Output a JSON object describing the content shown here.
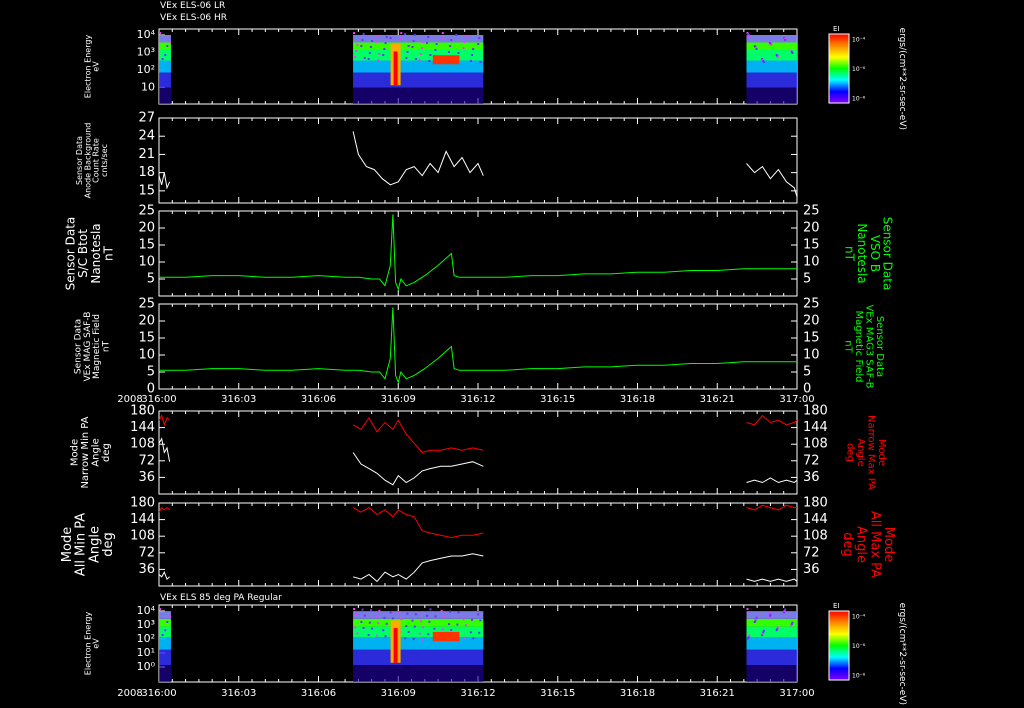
{
  "header": {
    "line1": "VEx ELS-06 LR",
    "line2": "VEx ELS-06 HR",
    "bottom_title": "VEx ELS 85 deg PA Regular"
  },
  "year_label": "2008",
  "colorbar": {
    "label": "EI",
    "units": "ergs/(cm**2-sr-sec-eV)",
    "ticks": [
      "10⁻⁴",
      "10⁻⁶",
      "10⁻⁸"
    ],
    "colors": [
      "#ff0000",
      "#ff8800",
      "#ffff00",
      "#00ff00",
      "#00ffff",
      "#0000ff",
      "#8800ff"
    ]
  },
  "colors": {
    "axis": "#ffffff",
    "green_series": "#00ff00",
    "red_series": "#ff0000",
    "white_series": "#ffffff"
  },
  "chart_data": [
    {
      "type": "heatmap",
      "id": "els-energy-top",
      "ylabel": [
        "Electron Energy",
        "eV"
      ],
      "ylim": [
        1,
        30000
      ],
      "yscale": "log",
      "yticks": [
        "10⁴",
        "10³",
        "10²",
        "10"
      ],
      "x": [
        "316:00",
        "316:03",
        "316:06",
        "316:09",
        "316:12",
        "316:15",
        "316:18",
        "316:21",
        "317:00"
      ],
      "data_intervals": [
        {
          "start": "316:00",
          "end": "316:00.5"
        },
        {
          "start": "316:07.3",
          "end": "316:12.2"
        },
        {
          "start": "316:22.1",
          "end": "317:00"
        }
      ]
    },
    {
      "type": "line",
      "id": "anode-background",
      "ylabel": [
        "Sensor Data",
        "Anode Background",
        "Count Rate",
        "cnts/sec"
      ],
      "ylim": [
        13,
        27
      ],
      "yticks": [
        15,
        18,
        21,
        24,
        27
      ],
      "series": [
        {
          "color": "white",
          "x": [
            0.0,
            0.1,
            0.2,
            0.3,
            0.4,
            7.3,
            7.5,
            7.8,
            8.1,
            8.4,
            8.7,
            9.0,
            9.3,
            9.6,
            9.9,
            10.2,
            10.5,
            10.8,
            11.1,
            11.4,
            11.7,
            12.0,
            12.2,
            22.1,
            22.4,
            22.7,
            23.0,
            23.3,
            23.6,
            23.9,
            24.0
          ],
          "y": [
            17.5,
            16,
            18,
            15.5,
            16.5,
            24.8,
            21,
            19,
            18.5,
            17,
            16,
            16.5,
            18.5,
            19,
            17.5,
            19.5,
            18,
            21.5,
            19,
            20.5,
            18,
            19.5,
            17.5,
            19.5,
            18,
            19,
            17,
            18.5,
            16.5,
            15.5,
            14
          ]
        }
      ]
    },
    {
      "type": "line",
      "id": "sc-btot",
      "ylabel": [
        "Sensor Data",
        "S/C Btot",
        "Nanotesla",
        "nT"
      ],
      "ylabel_right": [
        "Sensor Data",
        "VSO B",
        "Nanotesla",
        "nT"
      ],
      "ylim": [
        0,
        25
      ],
      "yticks": [
        5,
        10,
        15,
        20,
        25
      ],
      "series": [
        {
          "color": "green",
          "x": [
            0,
            1,
            2,
            3,
            4,
            5,
            6,
            7,
            7.5,
            8,
            8.3,
            8.5,
            8.7,
            8.8,
            8.9,
            9.0,
            9.1,
            9.3,
            9.6,
            10.0,
            10.5,
            11.0,
            11.1,
            11.3,
            12,
            13,
            14,
            15,
            16,
            17,
            18,
            19,
            20,
            21,
            22,
            23,
            24
          ],
          "y": [
            5.5,
            5.5,
            6,
            6,
            5.5,
            5.5,
            6,
            5.5,
            5.5,
            5,
            5,
            3,
            9,
            24,
            4,
            2,
            5,
            3,
            4,
            6,
            9,
            12.5,
            6,
            5.5,
            5.5,
            5.5,
            6,
            6,
            6.5,
            6.5,
            7,
            7,
            7.5,
            7.5,
            8,
            8,
            8
          ]
        }
      ]
    },
    {
      "type": "line",
      "id": "mag-saf-b",
      "ylabel": [
        "Sensor Data",
        "VEx MAG SAF-B",
        "Magnetic Field",
        "nT"
      ],
      "ylabel_right": [
        "Sensor Data",
        "VEx MAG3 SAF-B",
        "Magnetic Field",
        "nT"
      ],
      "ylim": [
        0,
        25
      ],
      "yticks": [
        0,
        5,
        10,
        15,
        20,
        25
      ],
      "x": [
        "316:00",
        "316:03",
        "316:06",
        "316:09",
        "316:12",
        "316:15",
        "316:18",
        "316:21",
        "317:00"
      ],
      "series": [
        {
          "color": "green",
          "x": [
            0,
            1,
            2,
            3,
            4,
            5,
            6,
            7,
            7.5,
            8,
            8.3,
            8.5,
            8.7,
            8.8,
            8.9,
            9.0,
            9.1,
            9.3,
            9.6,
            10.0,
            10.5,
            11.0,
            11.1,
            11.3,
            12,
            13,
            14,
            15,
            16,
            17,
            18,
            19,
            20,
            21,
            22,
            23,
            24
          ],
          "y": [
            5.5,
            5.5,
            6,
            6,
            5.5,
            5.5,
            6,
            5.5,
            5.5,
            5,
            5,
            3,
            9,
            24,
            4,
            2,
            5,
            3,
            4,
            6,
            9,
            12.5,
            6,
            5.5,
            5.5,
            5.5,
            6,
            6,
            6.5,
            6.5,
            7,
            7,
            7.5,
            7.5,
            8,
            8,
            8
          ]
        }
      ]
    },
    {
      "type": "line",
      "id": "narrow-pa",
      "ylabel": [
        "Mode",
        "Narrow Min PA",
        "Angle",
        "deg"
      ],
      "ylabel_right": [
        "Mode",
        "Narrow Max PA",
        "Angle",
        "deg"
      ],
      "ylim": [
        0,
        180
      ],
      "yticks": [
        36,
        72,
        108,
        144,
        180
      ],
      "series": [
        {
          "name": "Min PA",
          "color": "white",
          "x": [
            0.0,
            0.1,
            0.2,
            0.3,
            0.4,
            7.3,
            7.6,
            7.9,
            8.2,
            8.5,
            8.8,
            9.0,
            9.3,
            9.6,
            9.9,
            10.2,
            10.6,
            11.0,
            11.4,
            11.8,
            12.2,
            22.1,
            22.4,
            22.7,
            23.0,
            23.3,
            23.6,
            23.9,
            24.0
          ],
          "y": [
            110,
            120,
            90,
            100,
            70,
            90,
            65,
            55,
            45,
            30,
            20,
            40,
            25,
            35,
            50,
            55,
            60,
            60,
            65,
            70,
            60,
            25,
            30,
            25,
            35,
            25,
            30,
            25,
            30
          ]
        },
        {
          "name": "Max PA",
          "color": "red",
          "x": [
            0.0,
            0.1,
            0.2,
            0.3,
            0.4,
            7.3,
            7.6,
            7.9,
            8.2,
            8.5,
            8.8,
            9.0,
            9.3,
            9.6,
            9.9,
            10.2,
            10.6,
            11.0,
            11.4,
            11.8,
            12.2,
            22.1,
            22.4,
            22.7,
            23.0,
            23.3,
            23.6,
            23.9,
            24.0
          ],
          "y": [
            160,
            170,
            150,
            165,
            160,
            150,
            140,
            165,
            135,
            155,
            140,
            160,
            130,
            110,
            90,
            95,
            95,
            100,
            95,
            100,
            95,
            155,
            150,
            170,
            155,
            160,
            150,
            155,
            160
          ]
        }
      ]
    },
    {
      "type": "line",
      "id": "all-pa",
      "ylabel": [
        "Mode",
        "All Min PA",
        "Angle",
        "deg"
      ],
      "ylabel_right": [
        "Mode",
        "All Max PA",
        "Angle",
        "deg"
      ],
      "ylim": [
        0,
        180
      ],
      "yticks": [
        36,
        72,
        108,
        144,
        180
      ],
      "series": [
        {
          "name": "Min PA",
          "color": "white",
          "x": [
            0.0,
            0.1,
            0.2,
            0.3,
            0.4,
            7.3,
            7.6,
            7.9,
            8.2,
            8.5,
            8.8,
            9.0,
            9.3,
            9.6,
            9.9,
            10.2,
            10.6,
            11.0,
            11.4,
            11.8,
            12.2,
            22.1,
            22.4,
            22.7,
            23.0,
            23.3,
            23.6,
            23.9,
            24.0
          ],
          "y": [
            25,
            20,
            30,
            15,
            20,
            20,
            15,
            25,
            10,
            30,
            20,
            25,
            15,
            30,
            50,
            55,
            60,
            65,
            65,
            70,
            65,
            15,
            10,
            15,
            10,
            15,
            10,
            15,
            10
          ]
        },
        {
          "name": "Max PA",
          "color": "red",
          "x": [
            0.0,
            0.1,
            0.2,
            0.3,
            0.4,
            7.3,
            7.6,
            7.9,
            8.2,
            8.5,
            8.8,
            9.0,
            9.3,
            9.6,
            9.9,
            10.2,
            10.6,
            11.0,
            11.4,
            11.8,
            12.2,
            22.1,
            22.4,
            22.7,
            23.0,
            23.3,
            23.6,
            23.9,
            24.0
          ],
          "y": [
            160,
            170,
            165,
            170,
            165,
            170,
            160,
            170,
            155,
            165,
            150,
            165,
            155,
            150,
            120,
            115,
            110,
            105,
            110,
            110,
            115,
            170,
            165,
            175,
            170,
            165,
            175,
            170,
            170
          ]
        }
      ]
    },
    {
      "type": "heatmap",
      "id": "els-energy-85deg",
      "ylabel": [
        "Electron Energy",
        "eV"
      ],
      "ylim": [
        0.1,
        30000
      ],
      "yscale": "log",
      "yticks": [
        "10⁴",
        "10³",
        "10²",
        "10¹",
        "10⁰"
      ],
      "x": [
        "316:00",
        "316:03",
        "316:06",
        "316:09",
        "316:12",
        "316:15",
        "316:18",
        "316:21",
        "317:00"
      ],
      "data_intervals": [
        {
          "start": "316:00",
          "end": "316:00.5"
        },
        {
          "start": "316:07.3",
          "end": "316:12.2"
        },
        {
          "start": "316:22.1",
          "end": "317:00"
        }
      ]
    }
  ]
}
